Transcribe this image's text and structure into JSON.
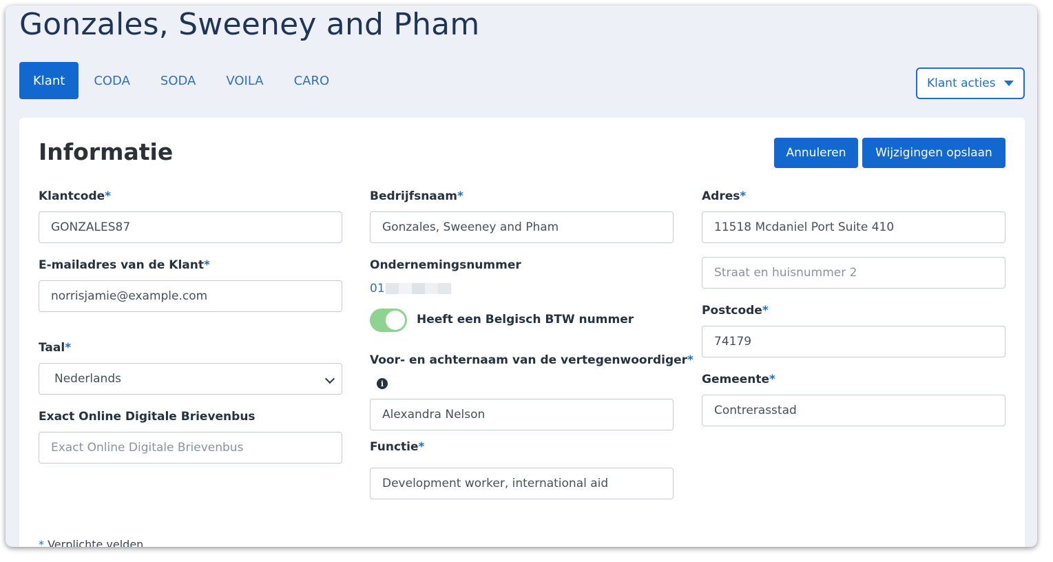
{
  "header": {
    "title": "Gonzales, Sweeney and Pham"
  },
  "tabs": [
    {
      "label": "Klant",
      "active": true
    },
    {
      "label": "CODA",
      "active": false
    },
    {
      "label": "SODA",
      "active": false
    },
    {
      "label": "VOILA",
      "active": false
    },
    {
      "label": "CARO",
      "active": false
    }
  ],
  "actions": {
    "label": "Klant acties"
  },
  "card": {
    "title": "Informatie",
    "cancel_label": "Annuleren",
    "save_label": "Wijzigingen opslaan"
  },
  "form": {
    "client_code": {
      "label": "Klantcode",
      "value": "GONZALES87"
    },
    "email": {
      "label": "E-mailadres van de Klant",
      "value": "norrisjamie@example.com"
    },
    "language": {
      "label": "Taal",
      "value": "Nederlands"
    },
    "exact_online": {
      "label": "Exact Online Digitale Brievenbus",
      "placeholder": "Exact Online Digitale Brievenbus"
    },
    "company_name": {
      "label": "Bedrijfsnaam",
      "value": "Gonzales, Sweeney and Pham"
    },
    "enterprise_number": {
      "label": "Ondernemingsnummer",
      "value_prefix": "01"
    },
    "belgian_vat": {
      "label": "Heeft een Belgisch BTW nummer",
      "checked": true
    },
    "representative": {
      "label": "Voor- en achternaam van de vertegenwoordiger",
      "value": "Alexandra Nelson"
    },
    "function": {
      "label": "Functie",
      "value": "Development worker, international aid"
    },
    "address": {
      "label": "Adres",
      "value": "11518 Mcdaniel Port Suite 410",
      "line2_placeholder": "Straat en huisnummer 2"
    },
    "postcode": {
      "label": "Postcode",
      "value": "74179"
    },
    "city": {
      "label": "Gemeente",
      "value": "Contrerasstad"
    },
    "required_mark": "*",
    "required_note": "Verplichte velden."
  },
  "colors": {
    "accent": "#1268cf",
    "toggle_on": "#8fd392",
    "background": "#edf1f7"
  }
}
